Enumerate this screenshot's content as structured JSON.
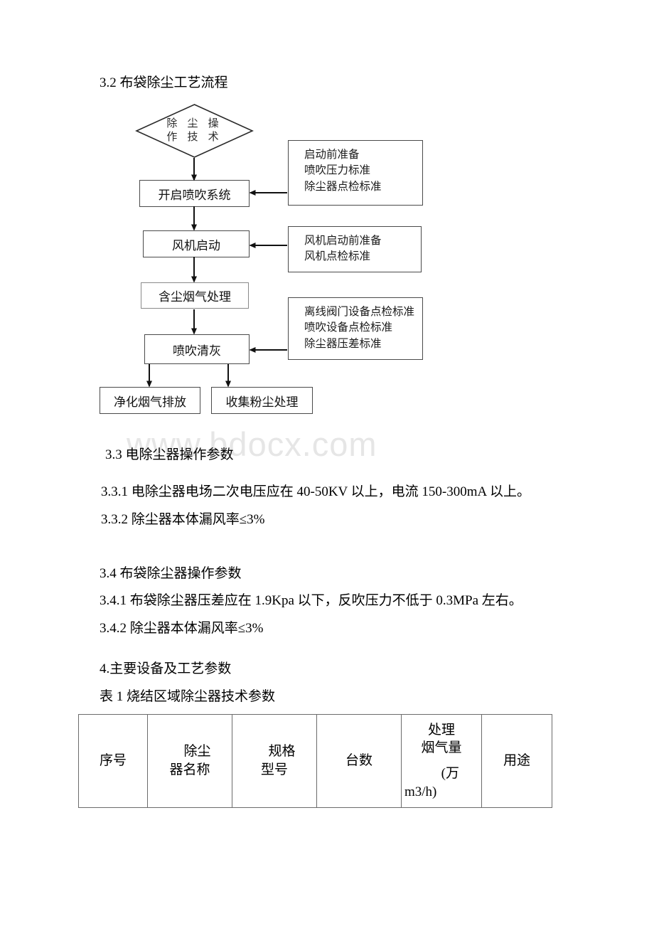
{
  "watermark": {
    "text": "www.bdocx.com"
  },
  "sections": {
    "s32_heading": "3.2 布袋除尘工艺流程",
    "s33_heading": "3.3 电除尘器操作参数",
    "s331": "3.3.1 电除尘器电场二次电压应在 40-50KV 以上，电流 150-300mA 以上。",
    "s332": "3.3.2 除尘器本体漏风率≤3%",
    "s34_heading": "3.4 布袋除尘器操作参数",
    "s341": "3.4.1 布袋除尘器压差应在 1.9Kpa 以下，反吹压力不低于 0.3MPa 左右。",
    "s342": "3.4.2 除尘器本体漏风率≤3%",
    "s4_heading": "4.主要设备及工艺参数",
    "table_caption": "表 1 烧结区域除尘器技术参数"
  },
  "flowchart": {
    "start": {
      "line1": "除 尘 操",
      "line2": "作 技 术"
    },
    "steps": [
      {
        "label": "开启喷吹系统"
      },
      {
        "label": "风机启动"
      },
      {
        "label": "含尘烟气处理"
      },
      {
        "label": "喷吹清灰"
      }
    ],
    "outputs": [
      {
        "label": "净化烟气排放"
      },
      {
        "label": "收集粉尘处理"
      }
    ],
    "notes": [
      {
        "lines": [
          "启动前准备",
          "喷吹压力标准",
          "除尘器点检标准"
        ]
      },
      {
        "lines": [
          "风机启动前准备",
          "风机点检标准"
        ]
      },
      {
        "lines": [
          "离线阀门设备点检标准",
          "喷吹设备点检标准",
          "除尘器压差标准"
        ]
      }
    ]
  },
  "table": {
    "headers": {
      "c1": "序号",
      "c2_line1": "除尘",
      "c2_line2": "器名称",
      "c3_line1": "规格",
      "c3_line2": "型号",
      "c4": "台数",
      "c5_line1": "处理",
      "c5_line2": "烟气量",
      "c5_line3": "(万",
      "c5_line4": "m3/h)",
      "c6": "用途"
    }
  },
  "colors": {
    "text": "#000000",
    "border": "#4a4a4a",
    "watermark": "#e6e6e6"
  }
}
